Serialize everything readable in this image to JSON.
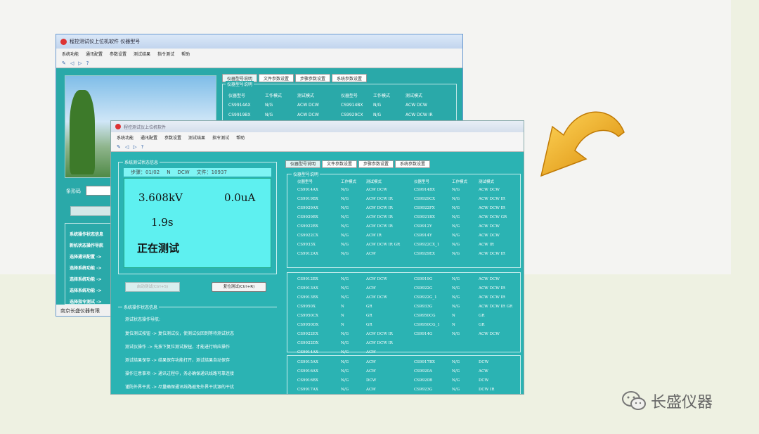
{
  "back_window": {
    "title": "程控测试仪上位机软件 仪器型号",
    "menu": [
      "系统功能",
      "通讯配置",
      "参数设置",
      "测试结果",
      "指令测试",
      "帮助"
    ],
    "barcode_label": "条形码",
    "tabs": [
      "仪器型号说明",
      "文件参数设置",
      "步骤参数设置",
      "系统参数设置"
    ],
    "group_title": "仪器型号说明",
    "columns": [
      "仪器型号",
      "工作模式",
      "测试模式",
      "仪器型号",
      "工作模式",
      "测试模式"
    ],
    "rows": [
      [
        "CS9914AX",
        "N/G",
        "ACW DCW",
        "CS9914BX",
        "N/G",
        "ACW DCW"
      ],
      [
        "CS9919BX",
        "N/G",
        "ACW DCW",
        "CS9929CX",
        "N/G",
        "ACW DCW IR"
      ]
    ],
    "status_group_title": "系统操作状态信息",
    "status_rows": [
      "系统操作状态信息",
      "新机状态操作导航",
      "选择通讯配置 ->",
      "选择系统功能 ->",
      "选择系统功能 ->",
      "选择系统功能 ->",
      "选择指令测试 ->"
    ],
    "footer": "南京长盛仪器有限"
  },
  "front_window": {
    "title": "程控测试仪上位机软件",
    "menu": [
      "系统功能",
      "通讯配置",
      "参数设置",
      "测试结果",
      "指令测试",
      "帮助"
    ],
    "status_group_title": "系统测试状态信息",
    "display": {
      "step": "步骤：01/02",
      "mode_n": "N",
      "mode": "DCW",
      "file": "文件：10937",
      "voltage": "3.608kV",
      "current": "0.0uA",
      "time": "1.9s",
      "state": "正在测试"
    },
    "buttons": {
      "start": "启动测试(Ctrl+S)",
      "reset": "复位测试(Ctrl+R)"
    },
    "op_group_title": "系统操作状态信息",
    "op_subtitle": "测试状态操作导航:",
    "op_lines": [
      "复位测试按钮 -> 复位测试仪，使测试仪回到等待测试状态",
      "测试仪操作  -> 先按下复位测试按钮，才能进行响应操作",
      "测试结果保存 -> 结果保存功能打开，测试结果自动保存",
      "操作注意事项 -> 通讯过程中，务必确保通讯线路可靠连接",
      "谨防外界干扰 -> 尽量确保通讯线路避免外界干扰源的干扰"
    ],
    "tabs": [
      "仪器型号说明",
      "文件参数设置",
      "步骤参数设置",
      "系统参数设置"
    ],
    "model_group_title": "仪器型号说明",
    "columns": [
      "仪器型号",
      "工作模式",
      "测试模式",
      "仪器型号",
      "工作模式",
      "测试模式"
    ],
    "group1": [
      [
        "CS9914AX",
        "N/G",
        "ACW DCW",
        "CS9914BX",
        "N/G",
        "ACW DCW"
      ],
      [
        "CS9919BX",
        "N/G",
        "ACW DCW IR",
        "CS9929CX",
        "N/G",
        "ACW DCW IR"
      ],
      [
        "CS9929AX",
        "N/G",
        "ACW DCW IR",
        "CS9922FX",
        "N/G",
        "ACW DCW IR"
      ],
      [
        "CS9929BX",
        "N/G",
        "ACW DCW IR",
        "CS9921BX",
        "N/G",
        "ACW DCW GR"
      ],
      [
        "CS9922BX",
        "N/G",
        "ACW DCW IR",
        "CS9912Y",
        "N/G",
        "ACW DCW"
      ],
      [
        "CS9922CX",
        "N/G",
        "ACW IR",
        "CS9914Y",
        "N/G",
        "ACW DCW"
      ],
      [
        "CS9933X",
        "N/G",
        "ACW DCW IR GR",
        "CS9922CX_1",
        "N/G",
        "ACW IR"
      ],
      [
        "CS9912AX",
        "N/G",
        "ACW",
        "CS9929EX",
        "N/G",
        "ACW DCW IR"
      ]
    ],
    "group2": [
      [
        "CS9912BX",
        "N/G",
        "ACW DCW",
        "CS9919G",
        "N/G",
        "ACW DCW"
      ],
      [
        "CS9913AX",
        "N/G",
        "ACW",
        "CS9922G",
        "N/G",
        "ACW DCW IR"
      ],
      [
        "CS9913BX",
        "N/G",
        "ACW DCW",
        "CS9922G_1",
        "N/G",
        "ACW DCW IR"
      ],
      [
        "CS9950X",
        "N",
        "GR",
        "CS9933G",
        "N/G",
        "ACW DCW IR GR"
      ],
      [
        "CS9950CX",
        "N",
        "GR",
        "CS9950CG",
        "N",
        "GR"
      ],
      [
        "CS9950DX",
        "N",
        "GR",
        "CS9950CG_1",
        "N",
        "GR"
      ],
      [
        "CS9922EX",
        "N/G",
        "ACW DCW IR",
        "CS9914G",
        "N/G",
        "ACW DCW"
      ],
      [
        "CS9922DX",
        "N/G",
        "ACW DCW IR",
        "",
        "",
        ""
      ],
      [
        "CS9914AX",
        "N/G",
        "ACW",
        "",
        "",
        ""
      ]
    ],
    "group3": [
      [
        "CS9915AX",
        "N/G",
        "ACW",
        "CS9917BX",
        "N/G",
        "DCW"
      ],
      [
        "CS9916AX",
        "N/G",
        "ACW",
        "CS9920A",
        "N/G",
        "ACW"
      ],
      [
        "CS9916BX",
        "N/G",
        "DCW",
        "CS9920B",
        "N/G",
        "DCW"
      ],
      [
        "CS9917AX",
        "N/G",
        "ACW",
        "CS9923G",
        "N/G",
        "DCW IR"
      ]
    ]
  },
  "watermark": {
    "text": "长盛仪器",
    "icon": "wechat-icon"
  },
  "colors": {
    "window_teal": "#2bb3b3",
    "display_cyan": "#5ef0f0",
    "arrow_gold": "#f0b21a"
  }
}
